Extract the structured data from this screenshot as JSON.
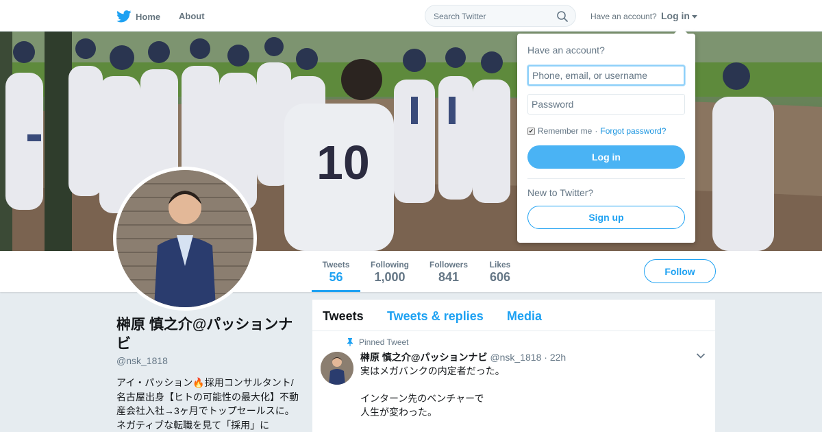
{
  "nav": {
    "home_label": "Home",
    "about_label": "About",
    "search_placeholder": "Search Twitter",
    "have_account": "Have an account?",
    "login_label": "Log in"
  },
  "colors": {
    "brand": "#1da1f2",
    "page_bg": "#e6ecf0",
    "muted": "#657786"
  },
  "profile": {
    "name": "榊原 慎之介@パッションナビ",
    "handle": "@nsk_1818",
    "bio": "アイ・パッション🔥採用コンサルタント/名古屋出身【ヒトの可能性の最大化】不動産会社入社→3ヶ月でトップセールスに。ネガティブな転職を見て「採用」に",
    "stats": [
      {
        "label": "Tweets",
        "value": "56"
      },
      {
        "label": "Following",
        "value": "1,000"
      },
      {
        "label": "Followers",
        "value": "841"
      },
      {
        "label": "Likes",
        "value": "606"
      }
    ],
    "follow_label": "Follow"
  },
  "timeline": {
    "tabs": [
      "Tweets",
      "Tweets & replies",
      "Media"
    ],
    "pinned_label": "Pinned Tweet",
    "tweet": {
      "author": "榊原 慎之介@パッションナビ",
      "handle": "@nsk_1818",
      "separator": "·",
      "time": "22h",
      "text": "実はメガバンクの内定者だった。\n\nインターン先のベンチャーで\n人生が変わった。"
    }
  },
  "login_dropdown": {
    "title": "Have an account?",
    "username_placeholder": "Phone, email, or username",
    "password_placeholder": "Password",
    "remember_label": "Remember me",
    "separator": "·",
    "forgot_label": "Forgot password?",
    "login_button": "Log in",
    "new_label": "New to Twitter?",
    "signup_button": "Sign up"
  }
}
